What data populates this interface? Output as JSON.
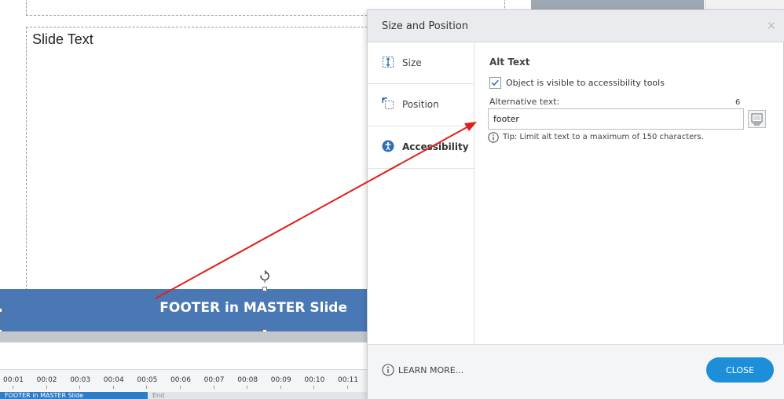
{
  "slide": {
    "placeholder_label": "Slide Text",
    "footer_text": "FOOTER in MASTER Slide"
  },
  "timeline": {
    "ticks": [
      "00:01",
      "00:02",
      "00:03",
      "00:04",
      "00:05",
      "00:06",
      "00:07",
      "00:08",
      "00:09",
      "00:10",
      "00:11"
    ],
    "track_label": "FOOTER in MASTER Slide",
    "track_end_label": "End"
  },
  "dialog": {
    "title": "Size and Position",
    "close_glyph": "×",
    "nav": [
      {
        "label": "Size",
        "icon": "size-icon"
      },
      {
        "label": "Position",
        "icon": "position-icon"
      },
      {
        "label": "Accessibility",
        "icon": "accessibility-icon",
        "active": true
      }
    ],
    "alt_text": {
      "section_title": "Alt Text",
      "checkbox_label": "Object is visible to accessibility tools",
      "checkbox_checked": true,
      "field_label": "Alternative text:",
      "char_count": "6",
      "value": "footer",
      "tip": "Tip: Limit alt text to a maximum of 150 characters."
    },
    "footer": {
      "learn_more": "LEARN MORE...",
      "close_label": "CLOSE"
    }
  },
  "colors": {
    "footer_bar": "#4a78b5",
    "close_button": "#1d8fd9",
    "check_mark": "#2e6fb8",
    "annotation_arrow": "#e0201b"
  }
}
